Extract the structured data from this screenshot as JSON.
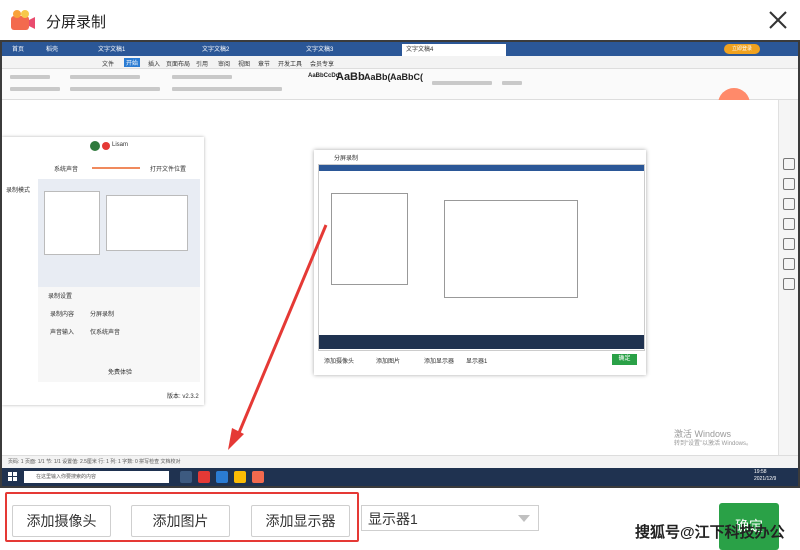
{
  "window": {
    "title": "分屏录制"
  },
  "inner_browser": {
    "tabs": [
      "首页",
      "稻壳",
      "文字文稿1",
      "文字文稿2",
      "文字文稿3",
      "文字文稿4"
    ],
    "menu": [
      "文件",
      "开始",
      "插入",
      "页面布局",
      "引用",
      "审阅",
      "视图",
      "章节",
      "开发工具",
      "会员专享"
    ],
    "styles": [
      "AaBbCcDd",
      "AaBb",
      "AaBb(",
      "AaBbC("
    ],
    "login_label": "立即登录",
    "record_time": "00:00:00",
    "status": "页码: 1  页面: 1/1  节: 1/1  设置值: 2.5厘米  行: 1  列: 1  字数: 0  拼写检查  文档校对",
    "taskbar_search": "在这里输入你要搜索的内容",
    "clock": "19:58\n2021/12/9",
    "activation": {
      "line1": "激活 Windows",
      "line2": "转到“设置”以激活 Windows。"
    }
  },
  "left_window": {
    "user": "Lisam",
    "labels": [
      "系统声音",
      "打开文件位置",
      "录制设置",
      "录制内容",
      "声音输入",
      "分屏录制",
      "仅系统声音",
      "免费体验",
      "版本: v2.3.2",
      "录制模式"
    ]
  },
  "center_window": {
    "title": "分屏录制",
    "buttons": [
      "添加摄像头",
      "添加图片",
      "添加显示器",
      "显示器1"
    ],
    "ok": "确定"
  },
  "bottom": {
    "add_camera": "添加摄像头",
    "add_image": "添加图片",
    "add_display": "添加显示器",
    "display_select": "显示器1",
    "confirm": "确定"
  },
  "watermark": "搜狐号@江下科技办公",
  "colors": {
    "accent": "#2aa147",
    "highlight": "#e53935"
  }
}
